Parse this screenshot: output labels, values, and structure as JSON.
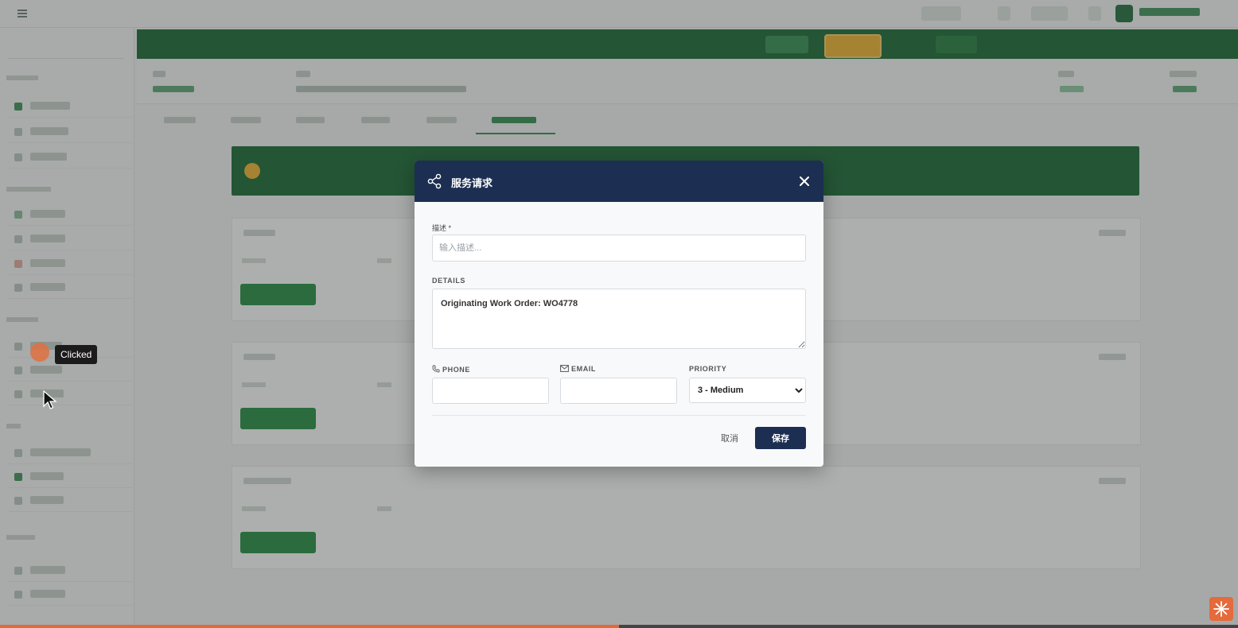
{
  "app": {
    "brand": "",
    "colors": {
      "primary_green": "#13652f",
      "modal_navy": "#1c2f52",
      "accent_yellow": "#f1b42a",
      "click_orange": "#e07040"
    }
  },
  "click_indicator": {
    "label": "Clicked"
  },
  "modal": {
    "title": "服务请求",
    "icons": {
      "header": "share-icon",
      "close": "close-icon"
    },
    "description": {
      "label": "描述 *",
      "placeholder": "输入描述...",
      "value": ""
    },
    "details": {
      "label": "DETAILS",
      "value": "Originating Work Order: WO4778"
    },
    "phone": {
      "label": "PHONE",
      "value": ""
    },
    "email": {
      "label": "EMAIL",
      "value": ""
    },
    "priority": {
      "label": "PRIORITY",
      "selected": "3 - Medium",
      "options": [
        "3 - Medium"
      ]
    },
    "cancel_label": "取消",
    "save_label": "保存"
  },
  "progress": {
    "fraction": 0.5
  }
}
